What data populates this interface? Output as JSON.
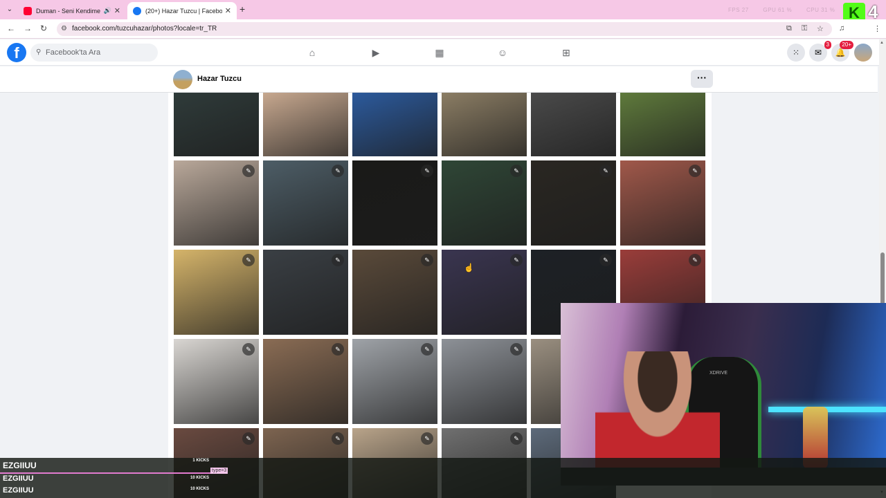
{
  "browser": {
    "tabs": [
      {
        "title": "Duman - Seni Kendime Sakl",
        "active": false,
        "favicon_color": "#ff0033"
      },
      {
        "title": "(20+) Hazar Tuzcu | Facebook",
        "active": true,
        "favicon_color": "#1877f2"
      }
    ],
    "url": "facebook.com/tuzcuhazar/photos?locale=tr_TR",
    "stats": {
      "fps": "FPS 27",
      "gpu": "GPU 61 %",
      "cpu": "CPU 31 %"
    },
    "overlay_number": "4"
  },
  "facebook": {
    "logo": "f",
    "search_placeholder": "Facebook'ta Ara",
    "nav_icons": [
      "home-icon",
      "video-icon",
      "marketplace-icon",
      "groups-icon",
      "gaming-icon"
    ],
    "messenger_badge": "3",
    "notifications_badge": "20+",
    "profile_name": "Hazar Tuzcu",
    "more_label": "···"
  },
  "photos": {
    "rows": [
      [
        "#2f3b3a",
        "#c7a88f",
        "#2c5a9c",
        "#8b7d64",
        "#4a4a4a",
        "#5f7a3c"
      ],
      [
        "#b9a89a",
        "#4d5d66",
        "#1a1a18",
        "#2f4636",
        "#2a2722",
        "#a0584a"
      ],
      [
        "#d5b46a",
        "#3a3f44",
        "#5a4a3a",
        "#3a3550",
        "#1d2126",
        "#9a3d3a"
      ],
      [
        "#d9d6d2",
        "#8a6c54",
        "#9fa3a8",
        "#8d9197",
        "#9a8f80",
        null
      ],
      [
        "#6a4a40",
        "#7d6450",
        "#b9a48a",
        "#707070",
        "#5d6a7a",
        null
      ]
    ]
  },
  "stream_chat": [
    {
      "user": "EZGIIUU",
      "kicks": "1 KICKS"
    },
    {
      "user": "EZGIIUU",
      "kicks": "10 KICKS"
    },
    {
      "user": "EZGIIUU",
      "kicks": "10 KICKS"
    }
  ],
  "chat_tag": "type=3",
  "webcam": {
    "chair_brand": "XDRIVE"
  }
}
